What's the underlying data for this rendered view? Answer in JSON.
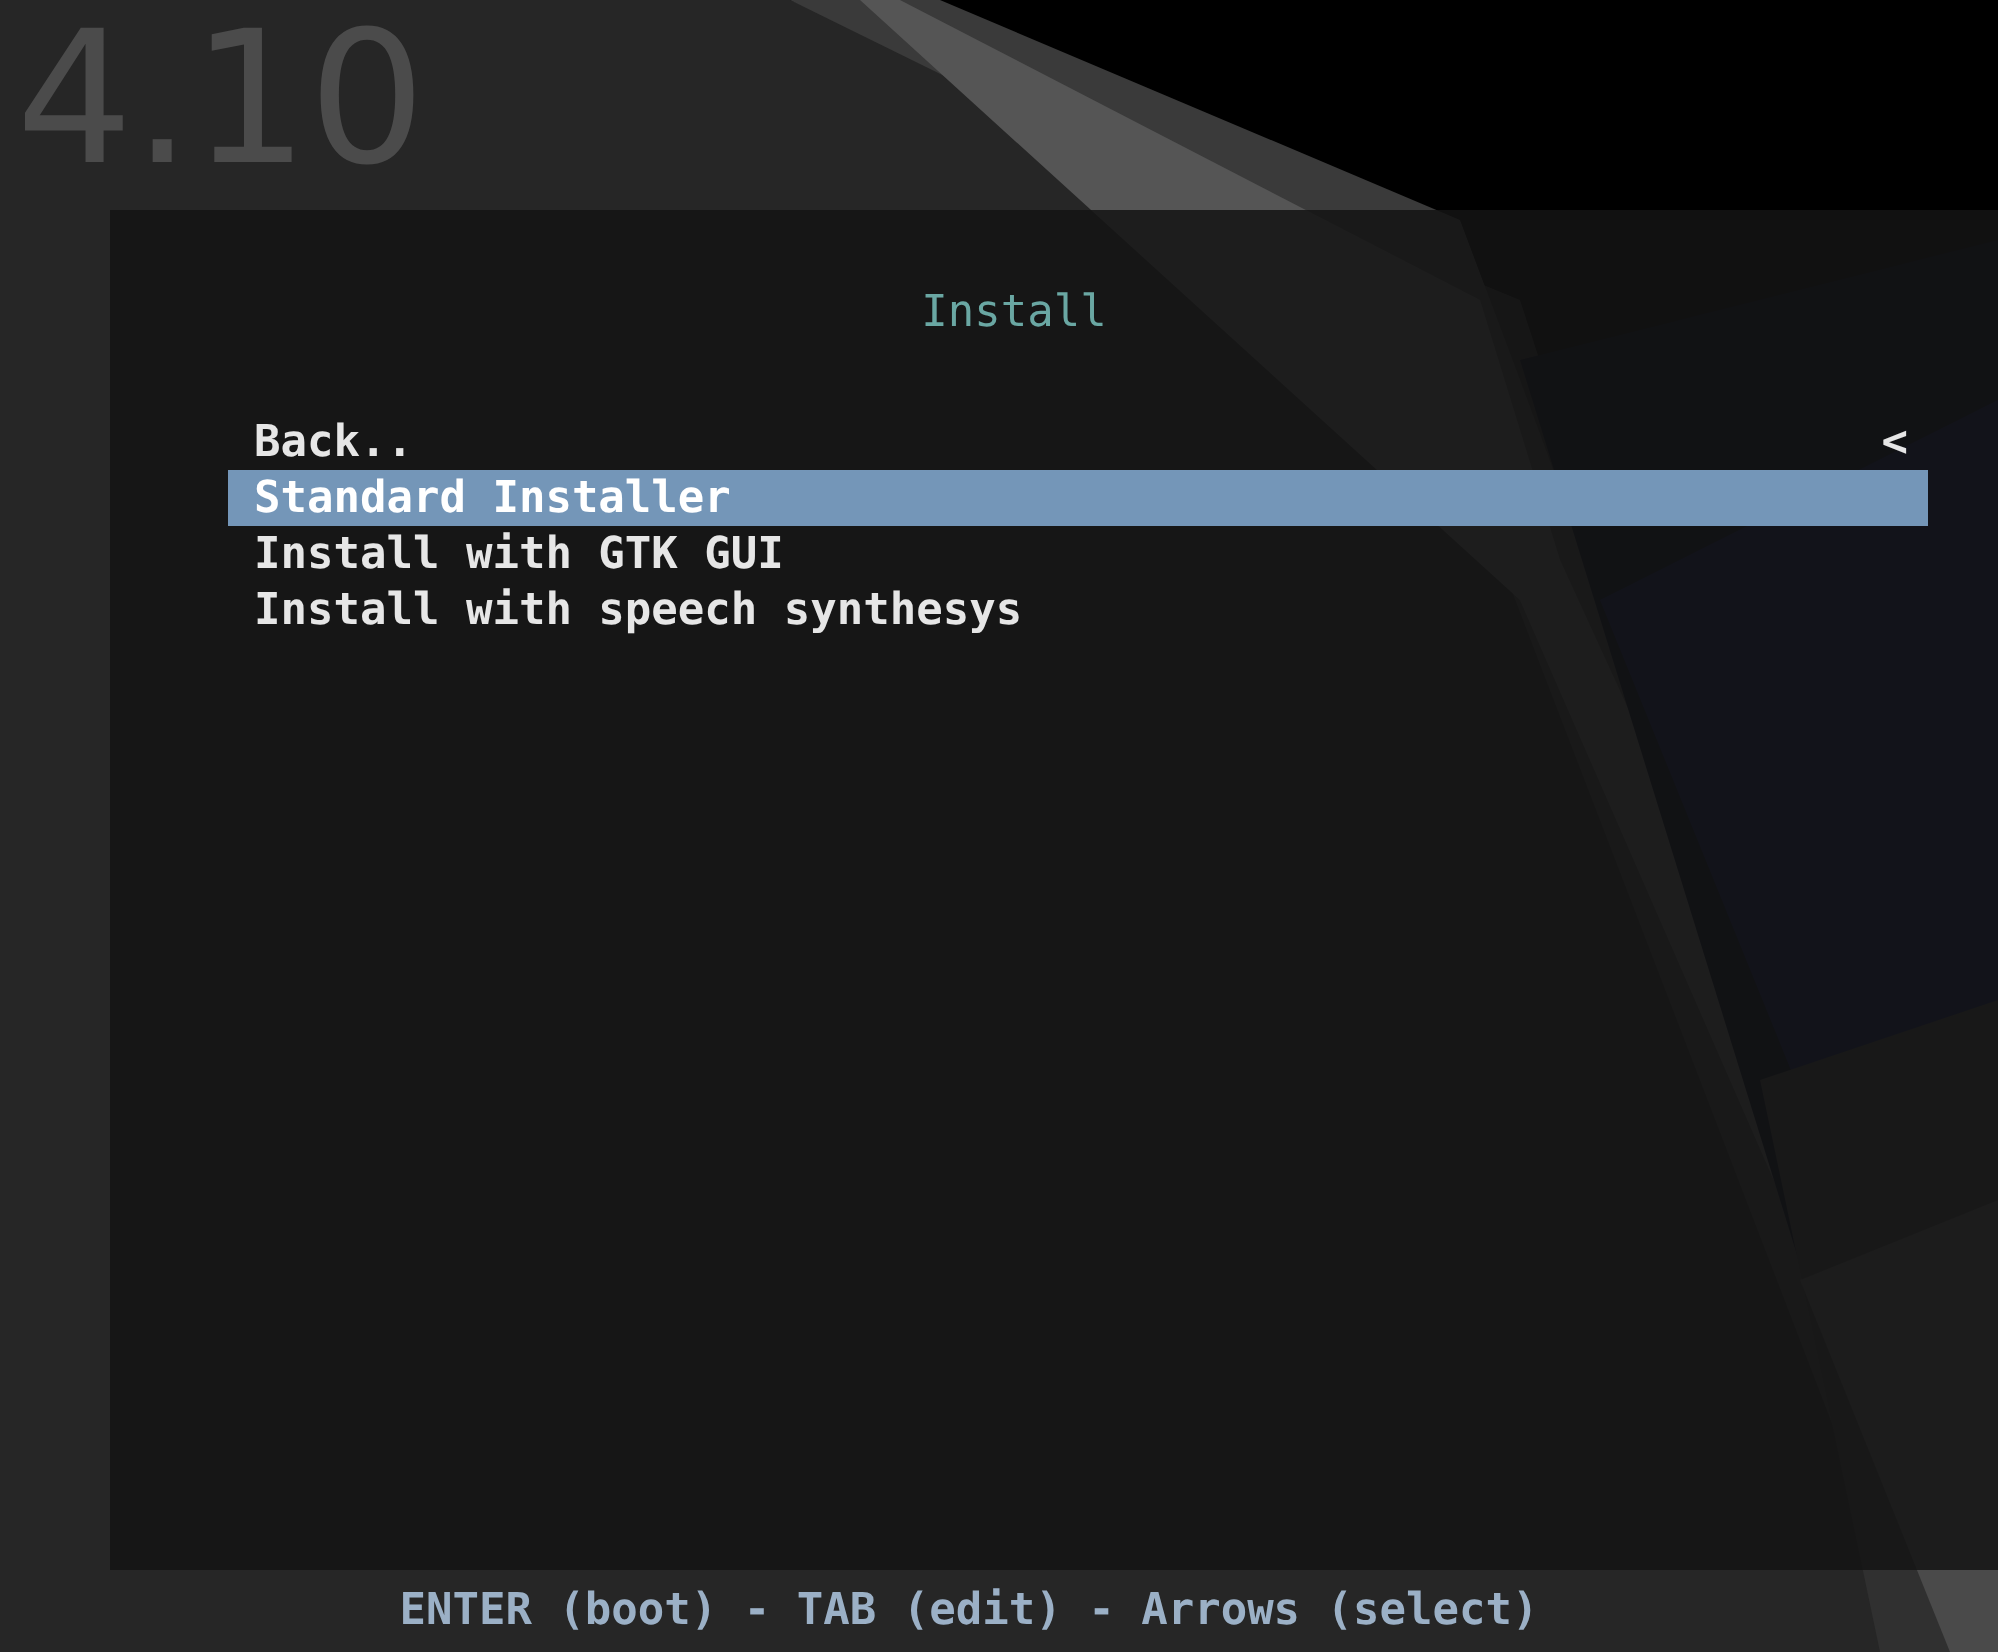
{
  "version": "4.10",
  "menu": {
    "title": "Install",
    "items": [
      {
        "label": "Back..",
        "selected": false,
        "marker": "<"
      },
      {
        "label": "Standard Installer",
        "selected": true
      },
      {
        "label": "Install with GTK GUI",
        "selected": false
      },
      {
        "label": "Install with speech synthesys",
        "selected": false
      }
    ]
  },
  "help_line": "ENTER (boot) - TAB (edit) - Arrows (select)"
}
